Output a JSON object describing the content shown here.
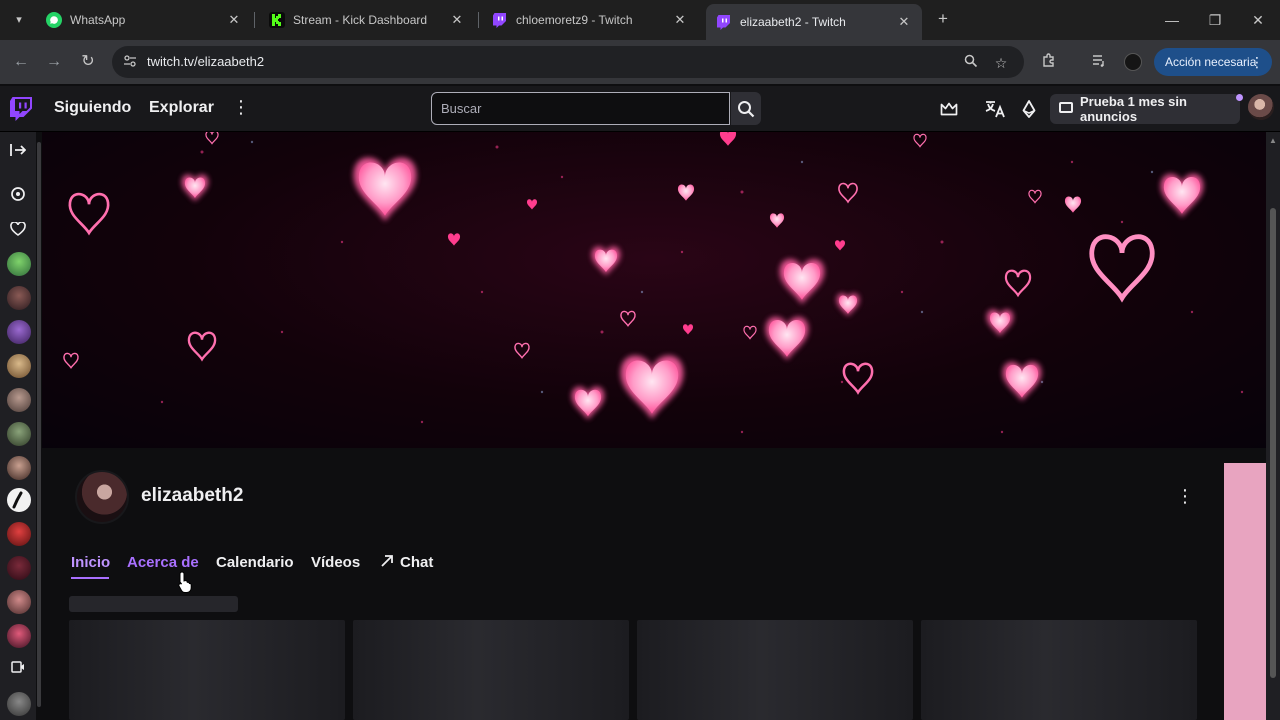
{
  "browser": {
    "tabs": [
      {
        "title": "WhatsApp",
        "icon": "whatsapp-icon",
        "color": "#25d366",
        "active": false
      },
      {
        "title": "Stream - Kick Dashboard",
        "icon": "kick-icon",
        "color": "#53fc18",
        "active": false
      },
      {
        "title": "chloemoretz9 - Twitch",
        "icon": "twitch-icon",
        "color": "#9146ff",
        "active": false
      },
      {
        "title": "elizaabeth2 - Twitch",
        "icon": "twitch-icon",
        "color": "#9146ff",
        "active": true
      }
    ],
    "url": "twitch.tv/elizaabeth2",
    "action_button": "Acción necesaria"
  },
  "twitch_nav": {
    "following": "Siguiendo",
    "browse": "Explorar",
    "search_placeholder": "Buscar",
    "promo": "Prueba 1 mes sin anuncios",
    "accent": "#9146ff"
  },
  "channel": {
    "name": "elizaabeth2",
    "tabs": [
      {
        "label": "Inicio",
        "active": true
      },
      {
        "label": "Acerca de",
        "active": false
      },
      {
        "label": "Calendario",
        "active": false
      },
      {
        "label": "Vídeos",
        "active": false
      },
      {
        "label": "Chat",
        "active": false
      }
    ]
  },
  "colors": {
    "tab_active": "#bf94ff",
    "heart_pink": "#ff5fa2",
    "heart_light": "#ffc2df"
  }
}
